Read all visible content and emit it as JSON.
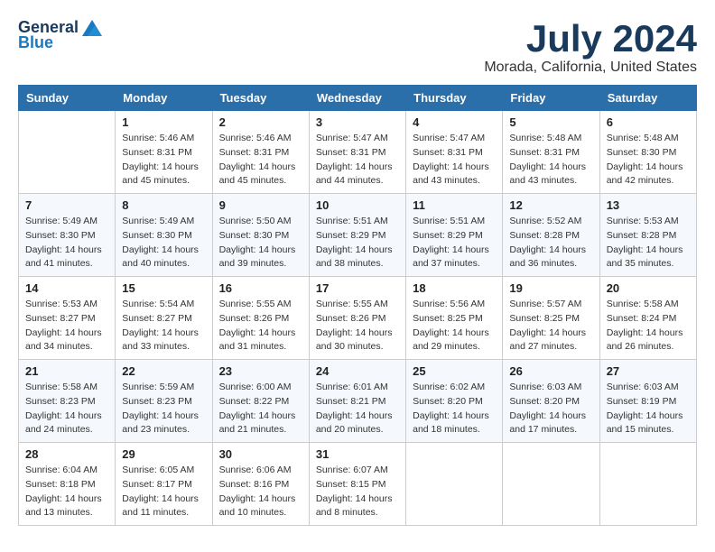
{
  "logo": {
    "general": "General",
    "blue": "Blue"
  },
  "title": "July 2024",
  "subtitle": "Morada, California, United States",
  "weekdays": [
    "Sunday",
    "Monday",
    "Tuesday",
    "Wednesday",
    "Thursday",
    "Friday",
    "Saturday"
  ],
  "weeks": [
    [
      {
        "day": "",
        "sunrise": "",
        "sunset": "",
        "daylight": ""
      },
      {
        "day": "1",
        "sunrise": "Sunrise: 5:46 AM",
        "sunset": "Sunset: 8:31 PM",
        "daylight": "Daylight: 14 hours and 45 minutes."
      },
      {
        "day": "2",
        "sunrise": "Sunrise: 5:46 AM",
        "sunset": "Sunset: 8:31 PM",
        "daylight": "Daylight: 14 hours and 45 minutes."
      },
      {
        "day": "3",
        "sunrise": "Sunrise: 5:47 AM",
        "sunset": "Sunset: 8:31 PM",
        "daylight": "Daylight: 14 hours and 44 minutes."
      },
      {
        "day": "4",
        "sunrise": "Sunrise: 5:47 AM",
        "sunset": "Sunset: 8:31 PM",
        "daylight": "Daylight: 14 hours and 43 minutes."
      },
      {
        "day": "5",
        "sunrise": "Sunrise: 5:48 AM",
        "sunset": "Sunset: 8:31 PM",
        "daylight": "Daylight: 14 hours and 43 minutes."
      },
      {
        "day": "6",
        "sunrise": "Sunrise: 5:48 AM",
        "sunset": "Sunset: 8:30 PM",
        "daylight": "Daylight: 14 hours and 42 minutes."
      }
    ],
    [
      {
        "day": "7",
        "sunrise": "Sunrise: 5:49 AM",
        "sunset": "Sunset: 8:30 PM",
        "daylight": "Daylight: 14 hours and 41 minutes."
      },
      {
        "day": "8",
        "sunrise": "Sunrise: 5:49 AM",
        "sunset": "Sunset: 8:30 PM",
        "daylight": "Daylight: 14 hours and 40 minutes."
      },
      {
        "day": "9",
        "sunrise": "Sunrise: 5:50 AM",
        "sunset": "Sunset: 8:30 PM",
        "daylight": "Daylight: 14 hours and 39 minutes."
      },
      {
        "day": "10",
        "sunrise": "Sunrise: 5:51 AM",
        "sunset": "Sunset: 8:29 PM",
        "daylight": "Daylight: 14 hours and 38 minutes."
      },
      {
        "day": "11",
        "sunrise": "Sunrise: 5:51 AM",
        "sunset": "Sunset: 8:29 PM",
        "daylight": "Daylight: 14 hours and 37 minutes."
      },
      {
        "day": "12",
        "sunrise": "Sunrise: 5:52 AM",
        "sunset": "Sunset: 8:28 PM",
        "daylight": "Daylight: 14 hours and 36 minutes."
      },
      {
        "day": "13",
        "sunrise": "Sunrise: 5:53 AM",
        "sunset": "Sunset: 8:28 PM",
        "daylight": "Daylight: 14 hours and 35 minutes."
      }
    ],
    [
      {
        "day": "14",
        "sunrise": "Sunrise: 5:53 AM",
        "sunset": "Sunset: 8:27 PM",
        "daylight": "Daylight: 14 hours and 34 minutes."
      },
      {
        "day": "15",
        "sunrise": "Sunrise: 5:54 AM",
        "sunset": "Sunset: 8:27 PM",
        "daylight": "Daylight: 14 hours and 33 minutes."
      },
      {
        "day": "16",
        "sunrise": "Sunrise: 5:55 AM",
        "sunset": "Sunset: 8:26 PM",
        "daylight": "Daylight: 14 hours and 31 minutes."
      },
      {
        "day": "17",
        "sunrise": "Sunrise: 5:55 AM",
        "sunset": "Sunset: 8:26 PM",
        "daylight": "Daylight: 14 hours and 30 minutes."
      },
      {
        "day": "18",
        "sunrise": "Sunrise: 5:56 AM",
        "sunset": "Sunset: 8:25 PM",
        "daylight": "Daylight: 14 hours and 29 minutes."
      },
      {
        "day": "19",
        "sunrise": "Sunrise: 5:57 AM",
        "sunset": "Sunset: 8:25 PM",
        "daylight": "Daylight: 14 hours and 27 minutes."
      },
      {
        "day": "20",
        "sunrise": "Sunrise: 5:58 AM",
        "sunset": "Sunset: 8:24 PM",
        "daylight": "Daylight: 14 hours and 26 minutes."
      }
    ],
    [
      {
        "day": "21",
        "sunrise": "Sunrise: 5:58 AM",
        "sunset": "Sunset: 8:23 PM",
        "daylight": "Daylight: 14 hours and 24 minutes."
      },
      {
        "day": "22",
        "sunrise": "Sunrise: 5:59 AM",
        "sunset": "Sunset: 8:23 PM",
        "daylight": "Daylight: 14 hours and 23 minutes."
      },
      {
        "day": "23",
        "sunrise": "Sunrise: 6:00 AM",
        "sunset": "Sunset: 8:22 PM",
        "daylight": "Daylight: 14 hours and 21 minutes."
      },
      {
        "day": "24",
        "sunrise": "Sunrise: 6:01 AM",
        "sunset": "Sunset: 8:21 PM",
        "daylight": "Daylight: 14 hours and 20 minutes."
      },
      {
        "day": "25",
        "sunrise": "Sunrise: 6:02 AM",
        "sunset": "Sunset: 8:20 PM",
        "daylight": "Daylight: 14 hours and 18 minutes."
      },
      {
        "day": "26",
        "sunrise": "Sunrise: 6:03 AM",
        "sunset": "Sunset: 8:20 PM",
        "daylight": "Daylight: 14 hours and 17 minutes."
      },
      {
        "day": "27",
        "sunrise": "Sunrise: 6:03 AM",
        "sunset": "Sunset: 8:19 PM",
        "daylight": "Daylight: 14 hours and 15 minutes."
      }
    ],
    [
      {
        "day": "28",
        "sunrise": "Sunrise: 6:04 AM",
        "sunset": "Sunset: 8:18 PM",
        "daylight": "Daylight: 14 hours and 13 minutes."
      },
      {
        "day": "29",
        "sunrise": "Sunrise: 6:05 AM",
        "sunset": "Sunset: 8:17 PM",
        "daylight": "Daylight: 14 hours and 11 minutes."
      },
      {
        "day": "30",
        "sunrise": "Sunrise: 6:06 AM",
        "sunset": "Sunset: 8:16 PM",
        "daylight": "Daylight: 14 hours and 10 minutes."
      },
      {
        "day": "31",
        "sunrise": "Sunrise: 6:07 AM",
        "sunset": "Sunset: 8:15 PM",
        "daylight": "Daylight: 14 hours and 8 minutes."
      },
      {
        "day": "",
        "sunrise": "",
        "sunset": "",
        "daylight": ""
      },
      {
        "day": "",
        "sunrise": "",
        "sunset": "",
        "daylight": ""
      },
      {
        "day": "",
        "sunrise": "",
        "sunset": "",
        "daylight": ""
      }
    ]
  ]
}
